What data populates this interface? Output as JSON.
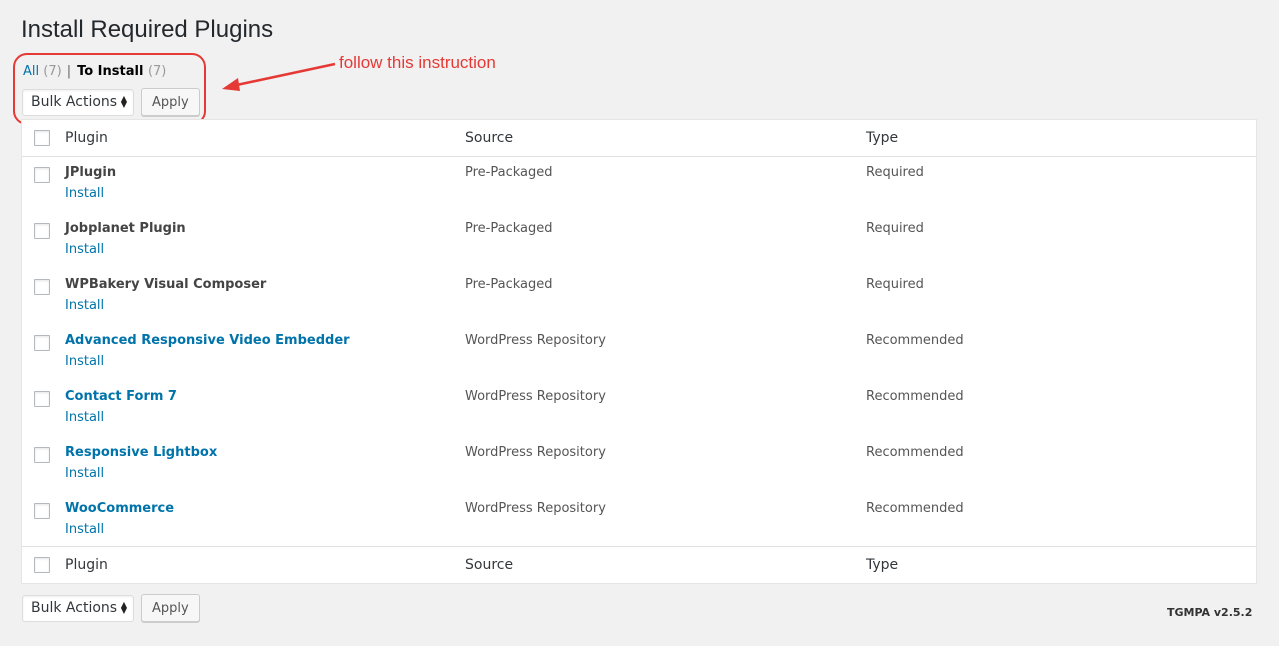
{
  "page": {
    "title": "Install Required Plugins"
  },
  "views": {
    "all_label": "All",
    "all_count": "(7)",
    "separator": "|",
    "to_install_label": "To Install",
    "to_install_count": "(7)"
  },
  "bulk_actions": {
    "selected": "Bulk Actions",
    "apply_label": "Apply"
  },
  "annotation": {
    "text": "follow this instruction",
    "color": "#e53935"
  },
  "table": {
    "columns": [
      "Plugin",
      "Source",
      "Type"
    ],
    "rows": [
      {
        "name": "JPlugin",
        "action": "Install",
        "source": "Pre-Packaged",
        "type": "Required"
      },
      {
        "name": "Jobplanet Plugin",
        "action": "Install",
        "source": "Pre-Packaged",
        "type": "Required"
      },
      {
        "name": "WPBakery Visual Composer",
        "action": "Install",
        "source": "Pre-Packaged",
        "type": "Required"
      },
      {
        "name": "Advanced Responsive Video Embedder",
        "action": "Install",
        "source": "WordPress Repository",
        "type": "Recommended"
      },
      {
        "name": "Contact Form 7",
        "action": "Install",
        "source": "WordPress Repository",
        "type": "Recommended"
      },
      {
        "name": "Responsive Lightbox",
        "action": "Install",
        "source": "WordPress Repository",
        "type": "Recommended"
      },
      {
        "name": "WooCommerce",
        "action": "Install",
        "source": "WordPress Repository",
        "type": "Recommended"
      }
    ]
  },
  "footer": {
    "version": "TGMPA v2.5.2"
  },
  "colors": {
    "link": "#0073aa",
    "background": "#f1f1f1"
  }
}
